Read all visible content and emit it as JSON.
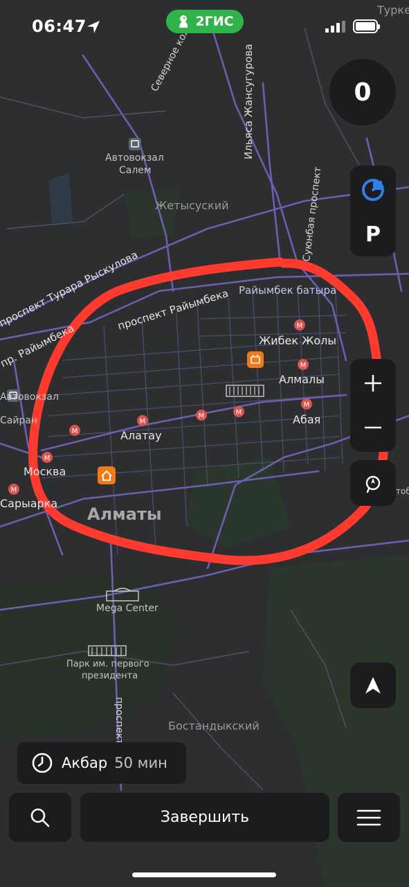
{
  "status_bar": {
    "time": "06:47",
    "brand": "2ГИС"
  },
  "speed": {
    "value": "0"
  },
  "side_controls": {
    "parking_label": "P"
  },
  "map": {
    "labels": {
      "turk": "Турке",
      "severnoe": "Северное кольцо",
      "ilyasa": "Ильяса Жансугурова",
      "avtovokzal_salem_1": "Автовокзал",
      "avtovokzal_salem_2": "Салем",
      "zhetysu": "Жетысуский",
      "suyunbay": "Суюнбая проспект",
      "ryskulova": "проспект Турара Рыскулова",
      "raiymbek_main": "проспект Райымбека",
      "raiymbek_left": "пр. Райымбека",
      "raiymbek_batyra": "Райымбек батыра",
      "zhibek": "Жибек Жолы",
      "almaly": "Алмалы",
      "abaya": "Абая",
      "alatau": "Алатау",
      "avtovokzal_sayran_1": "Автовокзал",
      "avtovokzal_sayran_2": "Сайран",
      "moskva": "Москва",
      "sarыarka": "Сарыарка",
      "almaty": "Алматы",
      "mega": "Mega Center",
      "park_1": "Парк им. первого",
      "park_2": "президента",
      "prospect_v": "проспект",
      "bostandyk": "Бостандыкский",
      "tob": "тоб"
    },
    "annotation_color": "#ff3b30",
    "metro_color": "#d9534f",
    "poi_color": "#f07a1a"
  },
  "eta": {
    "name": "Акбар",
    "time": "50 мин"
  },
  "bottom_bar": {
    "finish_label": "Завершить"
  }
}
